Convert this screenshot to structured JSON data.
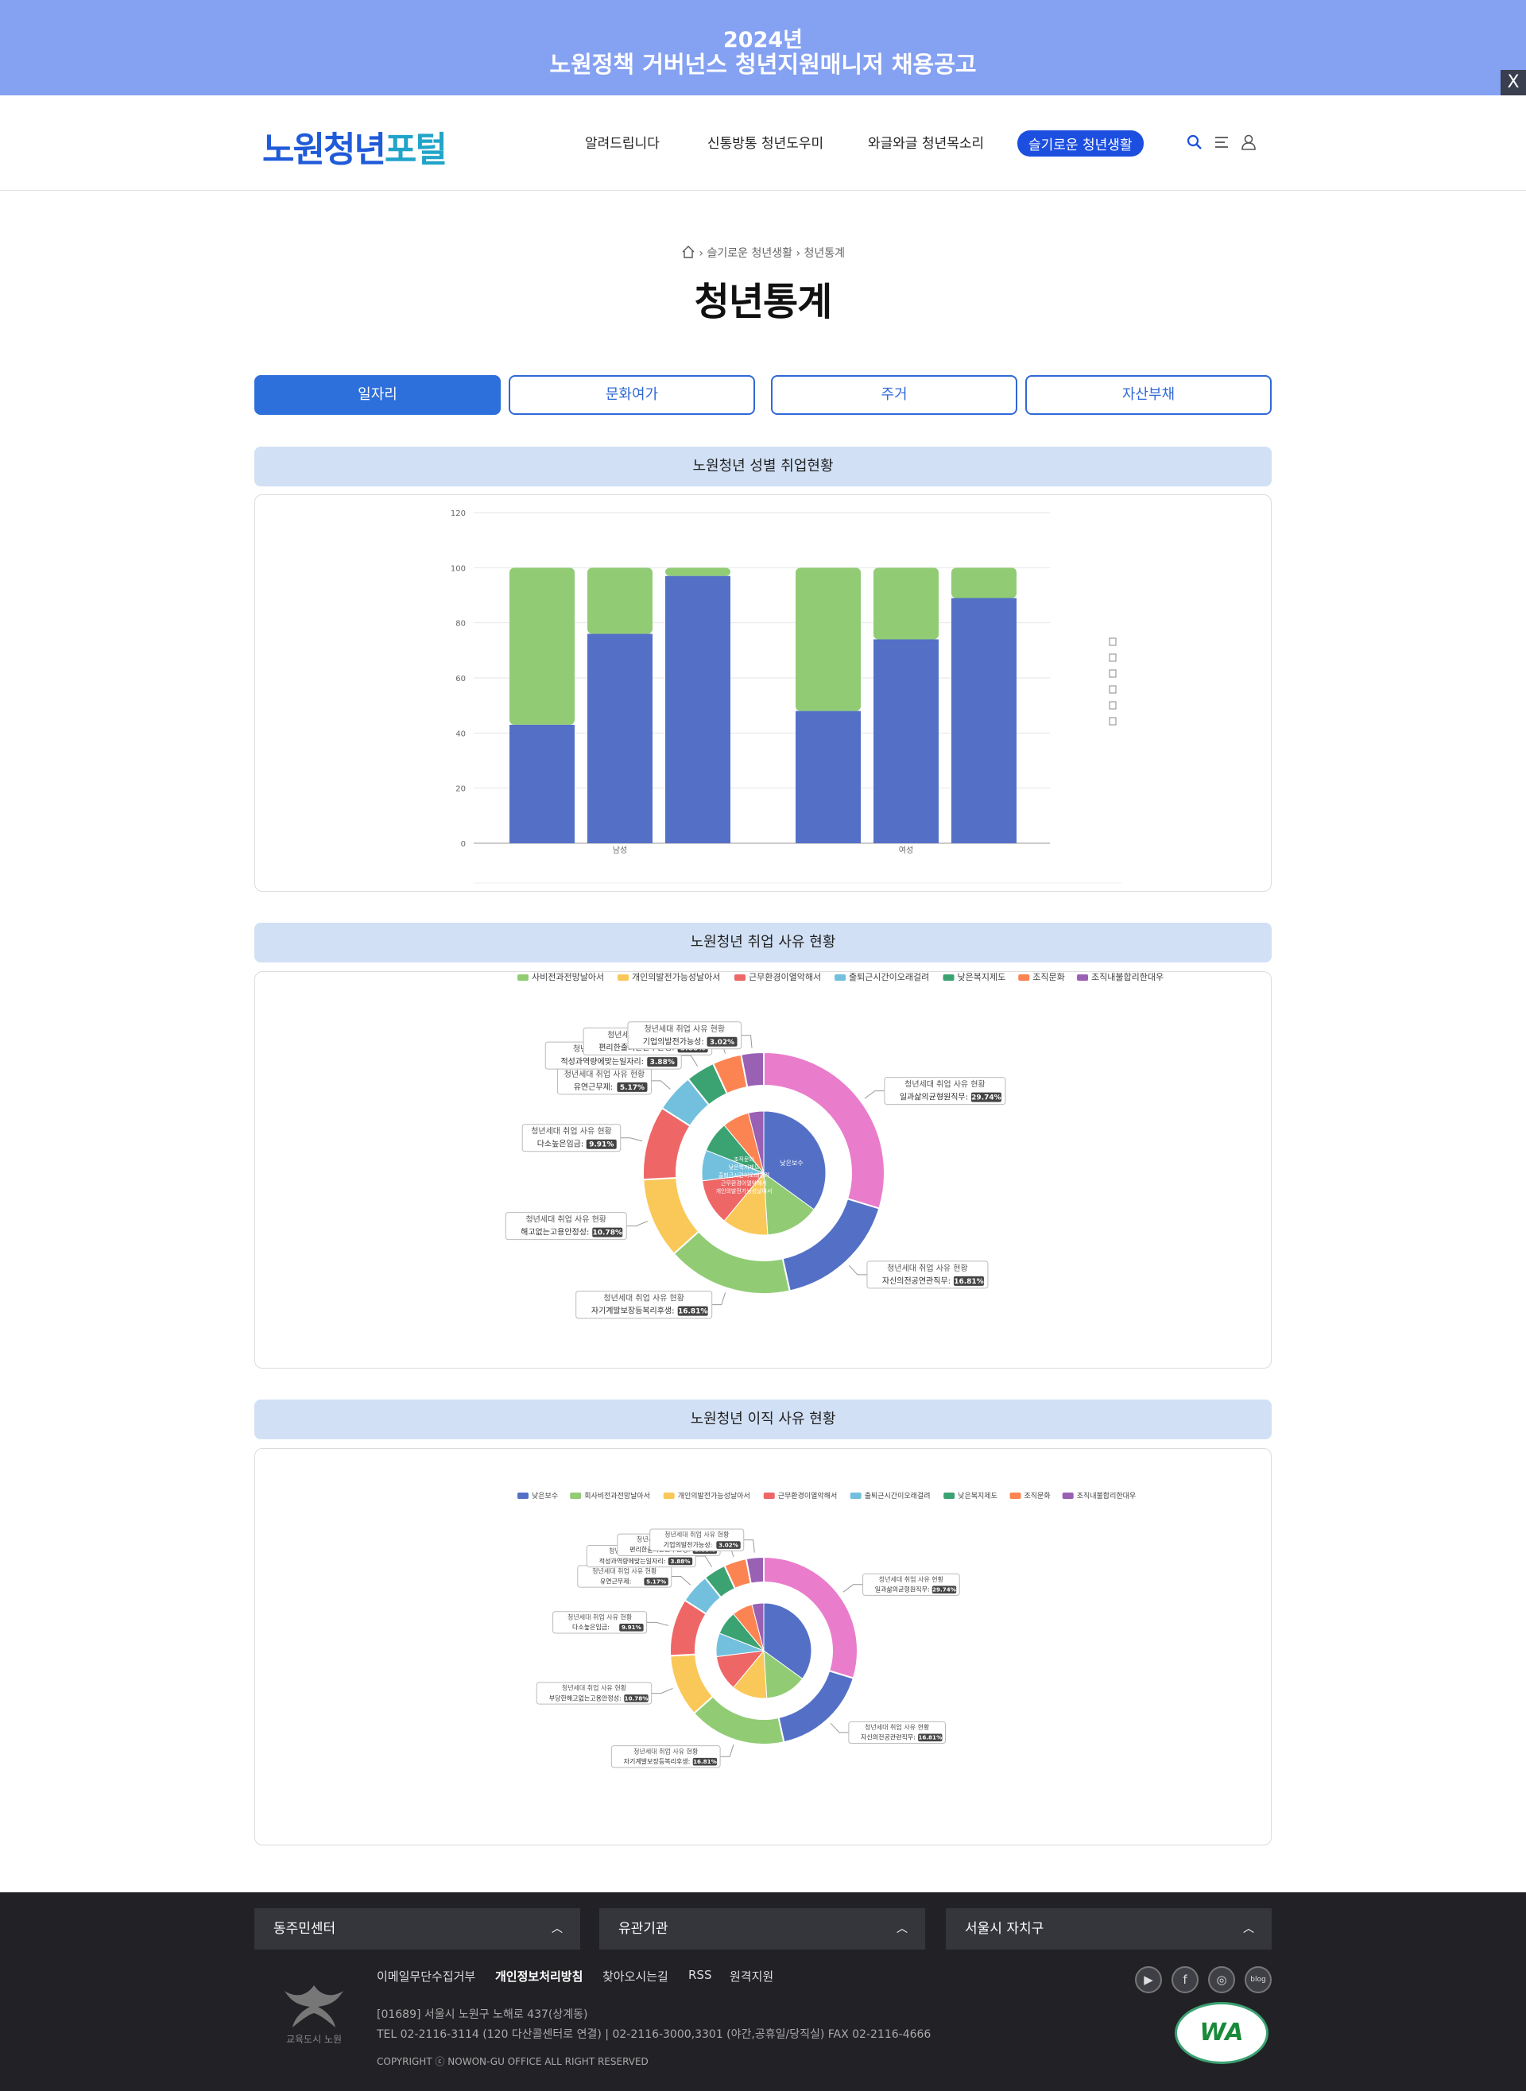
{
  "banner": {
    "line1": "2024년",
    "line2": "노원정책 거버넌스 청년지원매니저 채용공고",
    "close": "X"
  },
  "header": {
    "logo_part1": "노원청년",
    "logo_part2": "포털",
    "nav": [
      "알려드립니다",
      "신통방통 청년도우미",
      "와글와글 청년목소리",
      "슬기로운 청년생활"
    ]
  },
  "breadcrumb": {
    "item1": "슬기로운 청년생활",
    "item2": "청년통계"
  },
  "page_title": "청년통계",
  "tabs": [
    "일자리",
    "문화여가",
    "주거",
    "자산부채"
  ],
  "sections": {
    "s1": "노원청년 성별 취업현황",
    "s2": "노원청년 취업 사유 현황",
    "s3": "노원청년 이직 사유 현황"
  },
  "chart_data": [
    {
      "type": "bar",
      "title": "노원청년 성별 취업현황",
      "categories": [
        "남성",
        "여성"
      ],
      "stacked": true,
      "series": [
        {
          "color": "#5470c6",
          "values_male": [
            43,
            76,
            97
          ],
          "values_female": [
            48,
            74,
            89
          ]
        },
        {
          "color": "#91cc75",
          "values_male": [
            57,
            24,
            3
          ],
          "values_female": [
            52,
            26,
            11
          ]
        }
      ],
      "yticks": [
        0,
        20,
        40,
        60,
        80,
        100,
        120
      ],
      "ylim": [
        0,
        120
      ]
    },
    {
      "type": "pie",
      "title": "노원청년 취업 사유 현황",
      "legend": [
        "사비전과전망날아서",
        "개인의발전가능성날아서",
        "근무환경이열악해서",
        "출퇴근시간이오래걸려",
        "낮은복지제도",
        "조직문화",
        "조직내불합리한대우"
      ],
      "legend_colors": [
        "#91cc75",
        "#fac858",
        "#ee6666",
        "#73c0de",
        "#3ba272",
        "#fc8452",
        "#9a60b4"
      ],
      "inner_labels": [
        "낮은보수",
        "개인의발전가능성날아서",
        "근무환경이열악해서",
        "출퇴근시간이오래걸려",
        "낮은복지제도",
        "조직문화"
      ],
      "slice_series_label": "청년세대 취업 사유 현황",
      "slices": [
        {
          "name": "일과삶의균형원직무",
          "value": 29.74,
          "color": "#ea7ccc"
        },
        {
          "name": "자신의전공연관직무",
          "value": 16.81,
          "color": "#5470c6"
        },
        {
          "name": "자기계발보장등복리후생",
          "value": 16.81,
          "color": "#91cc75"
        },
        {
          "name": "해고없는고용안정성",
          "value": 10.78,
          "color": "#fac858"
        },
        {
          "name": "다소높은임금",
          "value": 9.91,
          "color": "#ee6666"
        },
        {
          "name": "유연근무제",
          "value": 5.17,
          "color": "#73c0de"
        },
        {
          "name": "적성과역량에맞는일자리",
          "value": 3.88,
          "color": "#3ba272"
        },
        {
          "name": "편리한출퇴근근무환경",
          "value": 3.88,
          "color": "#fc8452"
        },
        {
          "name": "기업의발전가능성",
          "value": 3.02,
          "color": "#9a60b4"
        }
      ]
    },
    {
      "type": "pie",
      "title": "노원청년 이직 사유 현황",
      "legend": [
        "낮은보수",
        "회사비전과전망날아서",
        "개인의발전가능성날아서",
        "근무환경이열악해서",
        "출퇴근시간이오래걸려",
        "낮은복지제도",
        "조직문화",
        "조직내불합리한대우"
      ],
      "legend_colors": [
        "#5470c6",
        "#91cc75",
        "#fac858",
        "#ee6666",
        "#73c0de",
        "#3ba272",
        "#fc8452",
        "#9a60b4"
      ],
      "slice_series_label": "청년세대 취업 사유 현황",
      "slices": [
        {
          "name": "일과삶의균형원직무",
          "value": 29.74,
          "color": "#ea7ccc"
        },
        {
          "name": "자신의전공관련직무",
          "value": 16.81,
          "color": "#5470c6"
        },
        {
          "name": "자기계발보장등복리후생",
          "value": 16.81,
          "color": "#91cc75"
        },
        {
          "name": "부당한해고없는고용안정성",
          "value": 10.78,
          "color": "#fac858"
        },
        {
          "name": "다소높은임금",
          "value": 9.91,
          "color": "#ee6666"
        },
        {
          "name": "유연근무제",
          "value": 5.17,
          "color": "#73c0de"
        },
        {
          "name": "적성과역량에맞는일자리",
          "value": 3.88,
          "color": "#3ba272"
        },
        {
          "name": "편리한출퇴근근무환경",
          "value": 3.88,
          "color": "#fc8452"
        },
        {
          "name": "기업의발전가능성",
          "value": 3.02,
          "color": "#9a60b4"
        }
      ]
    }
  ],
  "footer": {
    "selects": [
      "동주민센터",
      "유관기관",
      "서울시 자치구"
    ],
    "links": [
      "이메일무단수집거부",
      "개인정보처리방침",
      "찾아오시는길",
      "RSS",
      "원격지원"
    ],
    "address": "[01689] 서울시 노원구 노해로 437(상계동)",
    "tel": "TEL 02-2116-3114 (120 다산콜센터로 연결) | 02-2116-3000,3301 (야간,공휴일/당직실)     FAX 02-2116-4666",
    "copyright": "COPYRIGHT ⓒ NOWON-GU OFFICE ALL RIGHT RESERVED",
    "logo_text": "교육도시 노원",
    "wa_mark": "WA",
    "sns": [
      "▶",
      "f",
      "◎",
      "blog"
    ]
  },
  "colors": {
    "accent": "#1c4fe0",
    "tab_blue": "#2d6fdb",
    "section_bg": "#d1e0f5",
    "male_blue": "#5470c6",
    "green": "#91cc75"
  }
}
